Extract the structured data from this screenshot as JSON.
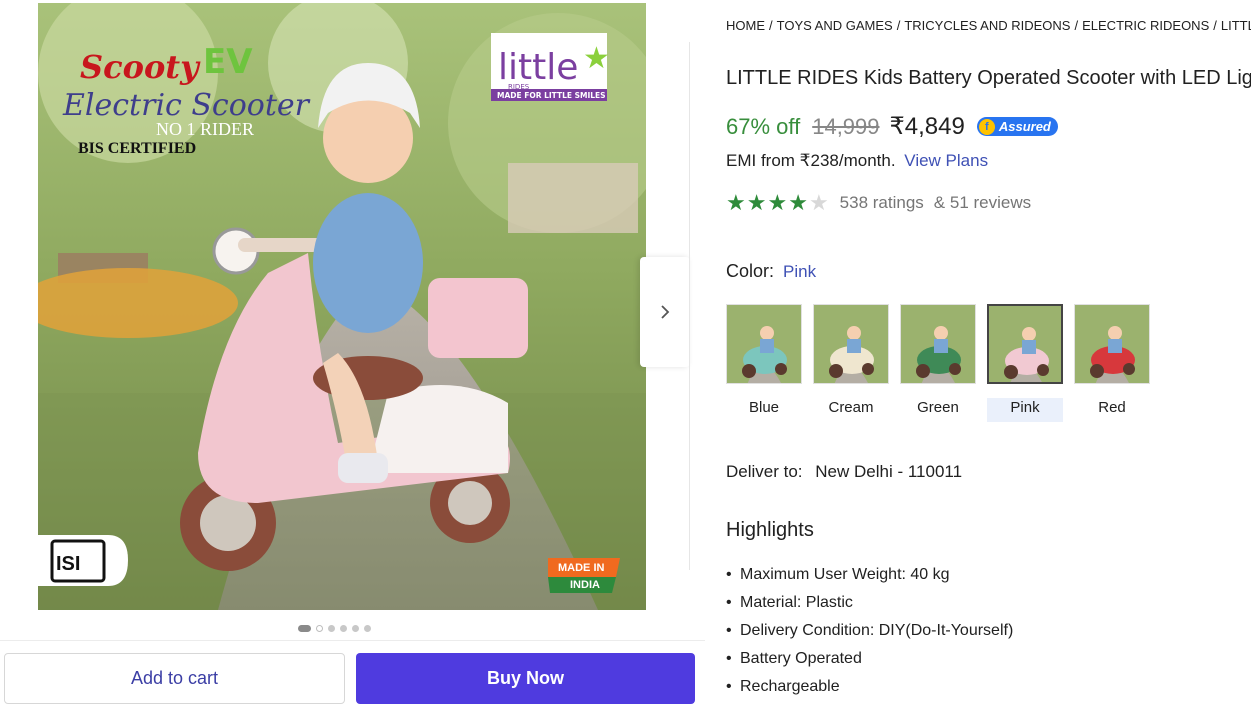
{
  "gallery": {
    "image_text": {
      "brand_script": "Scooty",
      "brand_ev": "EV",
      "subtitle_script": "Electric Scooter",
      "no1": "NO 1 RIDER",
      "bis": "BIS CERTIFIED",
      "logo_main": "little",
      "logo_sub": "RIDES",
      "logo_tagline": "MADE FOR LITTLE SMILES",
      "isi": "ISI",
      "made_in": "MADE IN",
      "india": "INDIA"
    },
    "dots_count": 6
  },
  "actions": {
    "add_to_cart": "Add to cart",
    "buy_now": "Buy Now"
  },
  "breadcrumb": [
    "HOME",
    "TOYS AND GAMES",
    "TRICYCLES AND RIDEONS",
    "ELECTRIC RIDEONS",
    "LITTLE RIDES ELECTRIC RIDEONS"
  ],
  "product": {
    "title": "LITTLE RIDES Kids Battery Operated Scooter with LED Lights & Music",
    "discount": "67% off",
    "mrp": "14,999",
    "price": "₹4,849",
    "assured": "Assured",
    "emi_text": "EMI from ₹238/month.",
    "emi_link": "View Plans",
    "rating_stars": 4,
    "ratings": "538 ratings",
    "reviews": "& 51 reviews"
  },
  "color": {
    "label": "Color:",
    "selected": "Pink",
    "options": [
      {
        "name": "Blue",
        "hex": "#7cc6bd"
      },
      {
        "name": "Cream",
        "hex": "#efe6cf"
      },
      {
        "name": "Green",
        "hex": "#3f8a57"
      },
      {
        "name": "Pink",
        "hex": "#f1c9d2"
      },
      {
        "name": "Red",
        "hex": "#d7383c"
      }
    ]
  },
  "delivery": {
    "label": "Deliver to:",
    "location": "New Delhi - 110011"
  },
  "highlights": {
    "title": "Highlights",
    "items": [
      "Maximum User Weight: 40 kg",
      "Material: Plastic",
      "Delivery Condition: DIY(Do-It-Yourself)",
      "Battery Operated",
      "Rechargeable"
    ]
  },
  "colors": {
    "discount_green": "#388e3c",
    "buy_now_bg": "#4f3bdf",
    "link_blue": "#3f51b5",
    "star_green": "#2e8b3a",
    "assured_blue": "#2874f0"
  }
}
